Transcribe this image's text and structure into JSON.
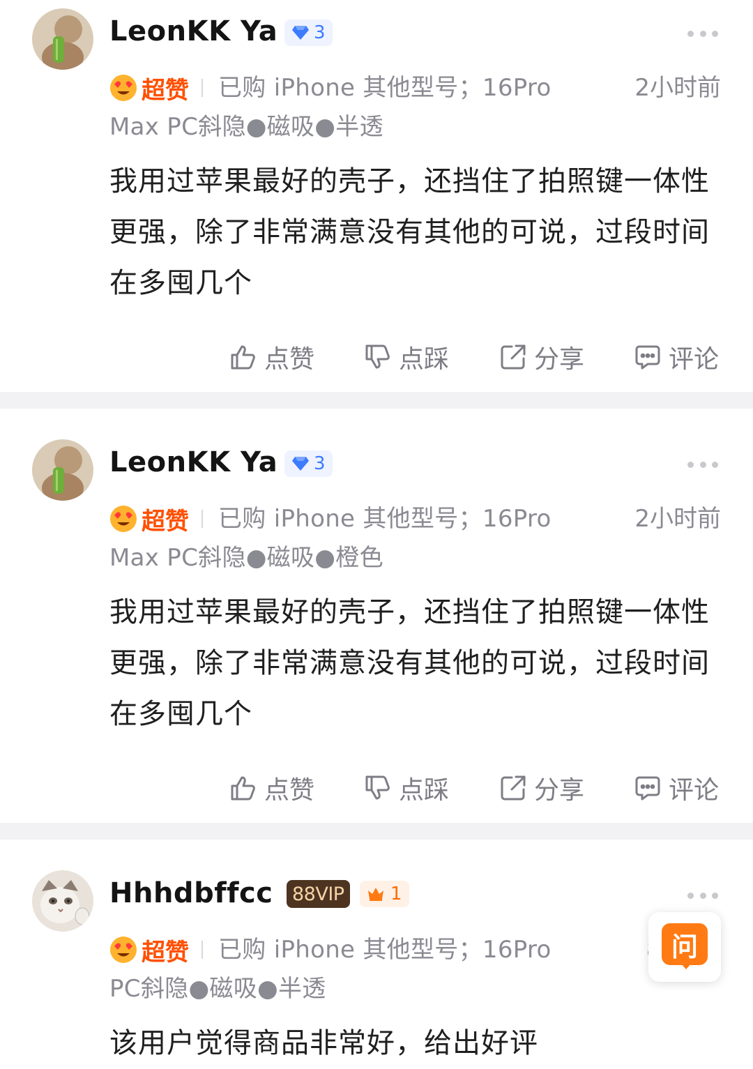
{
  "reviews": [
    {
      "username": "LeonKK Ya",
      "level": "3",
      "rating_label": "超赞",
      "spec_text": "已购 iPhone 其他型号；16Pro Max PC斜隐●磁吸●半透",
      "time": "2小时前",
      "content": "我用过苹果最好的壳子，还挡住了拍照键一体性更强，除了非常满意没有其他的可说，过段时间在多囤几个",
      "actions": {
        "like": "点赞",
        "dislike": "点踩",
        "share": "分享",
        "comment": "评论"
      }
    },
    {
      "username": "LeonKK Ya",
      "level": "3",
      "rating_label": "超赞",
      "spec_text": "已购 iPhone 其他型号；16Pro Max PC斜隐●磁吸●橙色",
      "time": "2小时前",
      "content": "我用过苹果最好的壳子，还挡住了拍照键一体性更强，除了非常满意没有其他的可说，过段时间在多囤几个",
      "actions": {
        "like": "点赞",
        "dislike": "点踩",
        "share": "分享",
        "comment": "评论"
      }
    },
    {
      "username": "Hhhdbffcc",
      "vip": "88VIP",
      "level": "1",
      "rating_label": "超赞",
      "spec_text": "已购 iPhone 其他型号；16Pro PC斜隐●磁吸●半透",
      "time": "8/",
      "content": "该用户觉得商品非常好，给出好评"
    }
  ],
  "ask_button": {
    "label": "问"
  },
  "colors": {
    "accent": "#ff5000",
    "ask": "#ff7a12",
    "level_blue": "#3d7bff",
    "vip_bg": "#4d3421"
  },
  "icons": [
    "thumb-up-icon",
    "thumb-down-icon",
    "share-icon",
    "comment-icon",
    "diamond-icon",
    "crown-icon",
    "heart-eyes-icon",
    "more-icon"
  ]
}
